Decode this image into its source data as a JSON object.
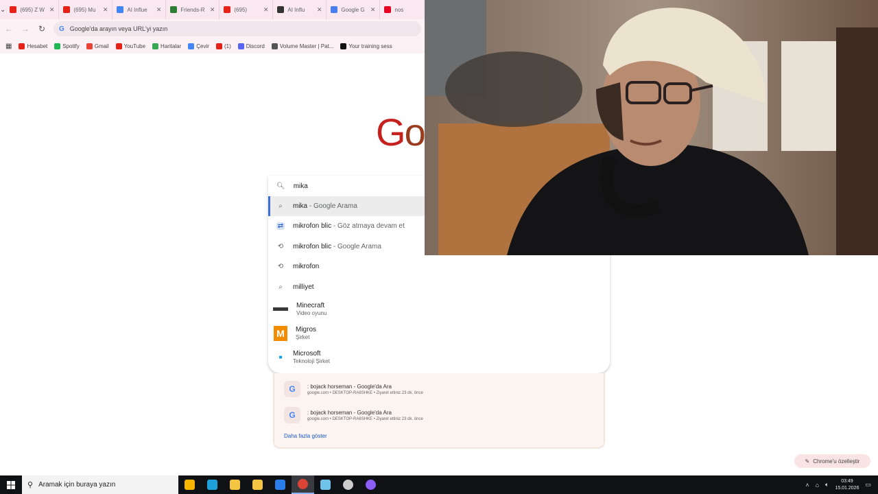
{
  "browser": {
    "tabs": [
      {
        "title": "(695) Z W",
        "icon": "youtube-icon",
        "color": "#e62117"
      },
      {
        "title": "(695) Mu",
        "icon": "youtube-icon",
        "color": "#e62117"
      },
      {
        "title": "AI Influe",
        "icon": "docs-icon",
        "color": "#4285f4"
      },
      {
        "title": "Friends-R",
        "icon": "friends-icon",
        "color": "#2e7d32"
      },
      {
        "title": "(695)",
        "icon": "youtube-icon",
        "color": "#e62117"
      },
      {
        "title": "AI Influ",
        "icon": "chatgpt-icon",
        "color": "#333333"
      },
      {
        "title": "Google G",
        "icon": "gemini-icon",
        "color": "#4a7df0"
      },
      {
        "title": "nos",
        "icon": "pinterest-icon",
        "color": "#e60023"
      }
    ],
    "omnibox_placeholder": "Google'da arayın veya URL'yi yazın",
    "bookmarks": [
      {
        "label": "Hesabet",
        "icon": "youtube-icon",
        "color": "#e62117"
      },
      {
        "label": "Spotify",
        "icon": "spotify-icon",
        "color": "#1db954"
      },
      {
        "label": "Gmail",
        "icon": "gmail-icon",
        "color": "#ea4335"
      },
      {
        "label": "YouTube",
        "icon": "youtube-icon",
        "color": "#e62117"
      },
      {
        "label": "Haritalar",
        "icon": "maps-icon",
        "color": "#34a853"
      },
      {
        "label": "Çevir",
        "icon": "translate-icon",
        "color": "#4285f4"
      },
      {
        "label": "(1)",
        "icon": "youtube-icon",
        "color": "#e62117"
      },
      {
        "label": "Discord",
        "icon": "discord-icon",
        "color": "#5865f2"
      },
      {
        "label": "Volume Master | Pat...",
        "icon": "circle-icon",
        "color": "#555555"
      },
      {
        "label": "Your training sess",
        "icon": "chatgpt-icon",
        "color": "#111111"
      }
    ]
  },
  "google": {
    "logo_text": "Go",
    "search_value": "mika",
    "suggestions": [
      {
        "icon": "search-icon",
        "text": "mika",
        "suffix": " - Google Arama",
        "highlighted": true
      },
      {
        "icon": "tab-switch-icon",
        "text": "mikrofon blic",
        "suffix": " - Göz atmaya devam et",
        "highlighted": false
      },
      {
        "icon": "history-icon",
        "text": "mikrofon blic",
        "suffix": " - Google Arama",
        "highlighted": false
      },
      {
        "icon": "history-icon",
        "text": "mikrofon",
        "suffix": "",
        "highlighted": false
      },
      {
        "icon": "search-icon",
        "text": "milliyet",
        "suffix": "",
        "highlighted": false
      }
    ],
    "rich_suggestions": [
      {
        "icon": "minecraft-logo",
        "title": "Minecraft",
        "subtitle": "Video oyunu"
      },
      {
        "icon": "migros-logo",
        "title": "Migros",
        "subtitle": "Şirket"
      },
      {
        "icon": "microsoft-logo",
        "title": "Microsoft",
        "subtitle": "Teknoloji Şirket"
      }
    ],
    "recent": [
      {
        "title": ": bojack horseman - Google'da Ara",
        "meta": "google.com • DESKTOP-RA6SHKE • Ziyaret ettiniz 23 dk. önce"
      },
      {
        "title": ": bojack horseman - Google'da Ara",
        "meta": "google.com • DESKTOP-RA6SHKE • Ziyaret ettiniz 23 dk. önce"
      }
    ],
    "show_more": "Daha fazla göster",
    "customize_label": "Chrome'u özelleştir"
  },
  "taskbar": {
    "search_placeholder": "Aramak için buraya yazın",
    "apps": [
      "copilot-icon",
      "edge-icon",
      "file-explorer-icon",
      "store-icon",
      "mail-icon",
      "chrome-icon",
      "notepad-icon",
      "obs-icon",
      "app-icon"
    ],
    "active_app": "chrome-icon",
    "time": "03:49",
    "date": "15.01.2026"
  },
  "colors": {
    "chrome_tabstrip": "#f9e8ef",
    "chrome_toolbar": "#fcf2f6",
    "highlight_border": "#3c6ee0",
    "taskbar": "#101114"
  }
}
